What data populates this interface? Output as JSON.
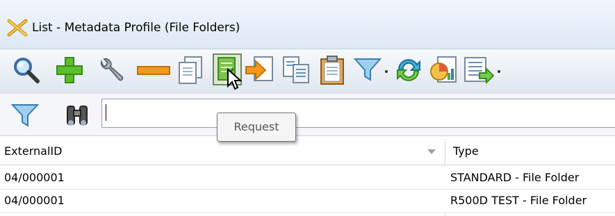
{
  "window": {
    "title": "List - Metadata Profile (File Folders)",
    "app_icon": "crossed-tools-icon"
  },
  "toolbar": {
    "buttons": [
      {
        "name": "search",
        "icon": "magnifier-icon"
      },
      {
        "name": "add",
        "icon": "plus-icon"
      },
      {
        "name": "edit",
        "icon": "wrench-icon"
      },
      {
        "name": "remove",
        "icon": "minus-icon"
      },
      {
        "name": "copy",
        "icon": "copy-document-icon"
      },
      {
        "name": "request",
        "icon": "request-document-icon"
      },
      {
        "name": "export",
        "icon": "export-arrow-icon"
      },
      {
        "name": "print-preview",
        "icon": "documents-icon"
      },
      {
        "name": "clipboard",
        "icon": "clipboard-icon"
      },
      {
        "name": "filter",
        "icon": "funnel-dropdown-icon"
      },
      {
        "name": "refresh",
        "icon": "refresh-icon"
      },
      {
        "name": "report",
        "icon": "chart-document-icon"
      },
      {
        "name": "columns",
        "icon": "list-dropdown-icon"
      }
    ],
    "tooltip": "Request"
  },
  "search": {
    "value": "",
    "filter_icon": "funnel-icon",
    "find_icon": "binoculars-icon"
  },
  "table": {
    "columns": [
      "ExternalID",
      "Type"
    ],
    "rows": [
      [
        "04/000001",
        "STANDARD - File Folder"
      ],
      [
        "04/000001",
        "R500D TEST - File Folder"
      ]
    ]
  }
}
